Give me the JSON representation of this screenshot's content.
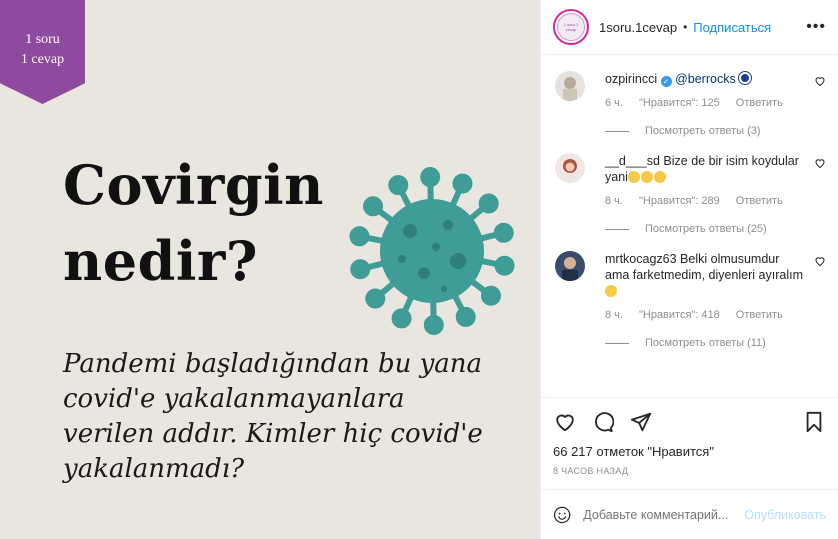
{
  "post": {
    "ribbon_line1": "1 soru",
    "ribbon_line2": "1 cevap",
    "headline_line1": "Covirgin",
    "headline_line2": "nedir?",
    "body_line1": "Pandemi başladığından bu yana",
    "body_line2": "covid'e yakalanmayanlara",
    "body_line3": "verilen addır. Kimler hiç covid'e",
    "body_line4": "yakalanmadı?"
  },
  "header": {
    "username": "1soru.1cevap",
    "dot": "•",
    "follow_label": "Подписаться",
    "more_label": "•••",
    "avatar_text": "1 soru 1 cevap"
  },
  "comments": [
    {
      "username": "ozpirincci",
      "mention": "@berrocks",
      "time": "6 ч.",
      "likes": "\"Нравится\": 125",
      "reply_label": "Ответить",
      "view_replies": "Посмотреть ответы (3)"
    },
    {
      "username": "__d___sd",
      "text": "Bize de bir isim koydular yani",
      "time": "8 ч.",
      "likes": "\"Нравится\": 289",
      "reply_label": "Ответить",
      "view_replies": "Посмотреть ответы (25)"
    },
    {
      "username": "mrtkocagz63",
      "text": "Belki olmusumdur ama farketmedim, diyenleri ayıralım",
      "time": "8 ч.",
      "likes": "\"Нравится\": 418",
      "reply_label": "Ответить",
      "view_replies": "Посмотреть ответы (11)"
    }
  ],
  "footer": {
    "likes_count": "66 217 отметок \"Нравится\"",
    "posted_time": "8 ЧАСОВ НАЗАД",
    "comment_placeholder": "Добавьте комментарий...",
    "publish_label": "Опубликовать"
  },
  "colors": {
    "ribbon": "#8e4a9e",
    "virus": "#3f9c96",
    "link_blue": "#0095f6",
    "image_bg": "#e9e6e0"
  }
}
